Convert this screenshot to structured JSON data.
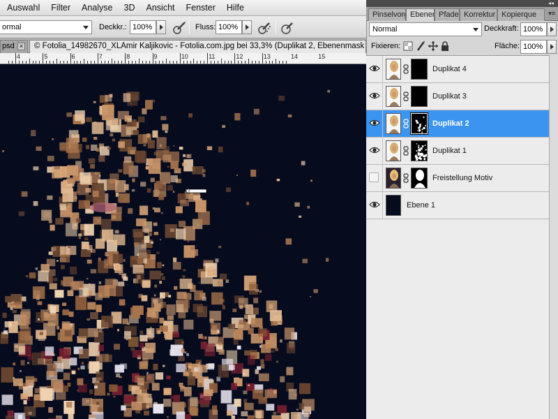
{
  "menu": [
    "Auswahl",
    "Filter",
    "Analyse",
    "3D",
    "Ansicht",
    "Fenster",
    "Hilfe"
  ],
  "options": {
    "mode_value": "ormal",
    "opacity_label": "Deckkr.:",
    "opacity_value": "100%",
    "flow_label": "Fluss:",
    "flow_value": "100%"
  },
  "doc_tabs": {
    "prev_label": "psd",
    "close_glyph": "×",
    "active_title": "© Fotolia_14982670_XLAmir Kaljikovic - Fotolia.com.jpg bei 33,3% (Duplikat 2, Ebenenmask"
  },
  "ruler": [
    4,
    5,
    6,
    7,
    8,
    9,
    10,
    11,
    12,
    13,
    14,
    15
  ],
  "panel": {
    "tabs": [
      "Pinselvorg",
      "Ebenen",
      "Pfade",
      "Korrektur",
      "Kopierque"
    ],
    "active_tab": "Ebenen",
    "blend_mode": "Normal",
    "opacity_label": "Deckkraft:",
    "opacity_value": "100%",
    "lock_label": "Fixieren:",
    "fill_label": "Fläche:",
    "fill_value": "100%",
    "collapse_glyph": "◂◂",
    "menu_glyph": "▾≡"
  },
  "layers": [
    {
      "name": "Duplikat 4",
      "visible": true,
      "selected": false,
      "mask": "black"
    },
    {
      "name": "Duplikat 3",
      "visible": true,
      "selected": false,
      "mask": "black"
    },
    {
      "name": "Duplikat 2",
      "visible": true,
      "selected": true,
      "mask": "sparse"
    },
    {
      "name": "Duplikat 1",
      "visible": true,
      "selected": false,
      "mask": "dense"
    },
    {
      "name": "Freistellung Motiv",
      "visible": false,
      "selected": false,
      "mask": "silhouette"
    },
    {
      "name": "Ebene 1",
      "visible": true,
      "selected": false,
      "mask": "none"
    }
  ],
  "colors": {
    "canvas_bg": "#060b1e",
    "selection": "#3b95f0",
    "skin": "#c08858"
  }
}
